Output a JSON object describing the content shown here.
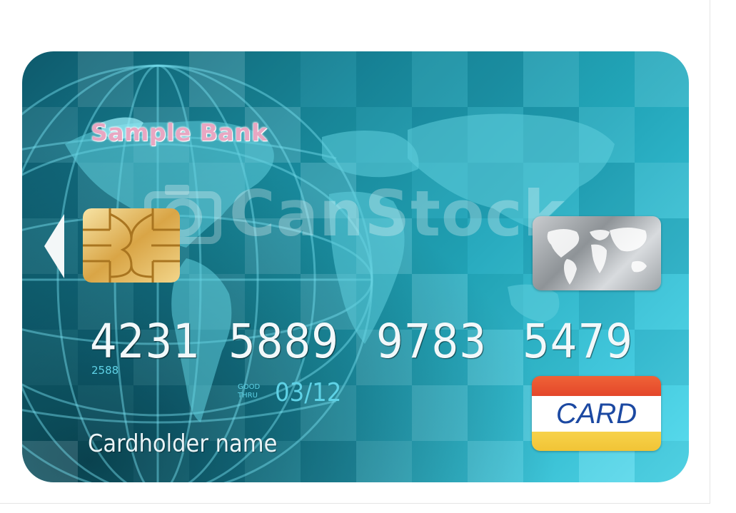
{
  "card": {
    "bank_name": "Sample Bank",
    "watermark": "CanStock",
    "number_groups": [
      "4231",
      "5889",
      "9783",
      "5479"
    ],
    "sub_number": "2588",
    "good_thru_line1": "GOOD",
    "good_thru_line2": "THRU",
    "expiry": "03/12",
    "cardholder": "Cardholder name",
    "brand_label": "CARD"
  },
  "colors": {
    "card_primary": "#1a8da0",
    "card_light": "#57dcef",
    "text_light": "#f2f8fa",
    "accent_cyan": "#5fd2e6",
    "brand_red": "#e4472a",
    "brand_blue": "#1c49a2",
    "brand_yellow": "#f1c436"
  },
  "icons": [
    "chip-icon",
    "left-arrow-icon",
    "hologram-world-map-icon",
    "camera-icon",
    "globe-graphic",
    "world-map-graphic"
  ]
}
